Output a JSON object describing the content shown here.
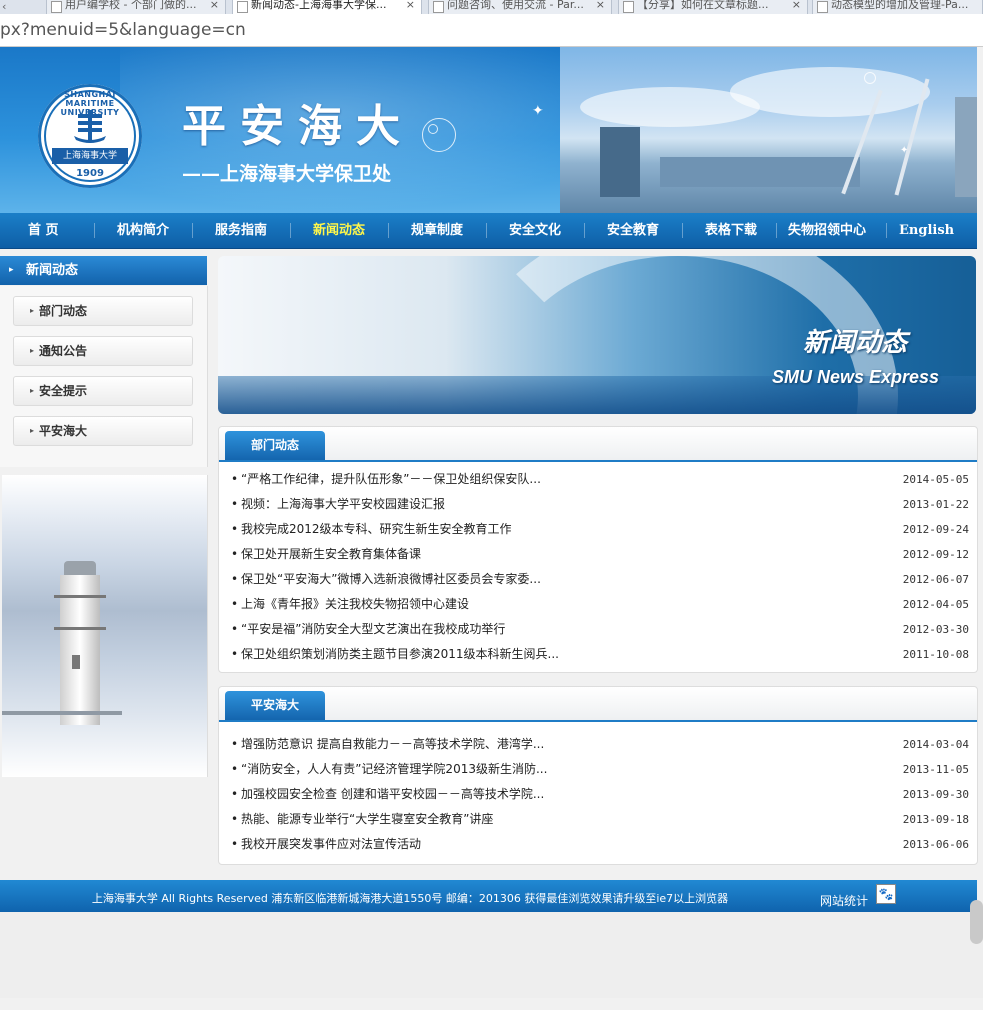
{
  "browser": {
    "tabs": [
      {
        "label": "用户编学校 - 个部门做的..."
      },
      {
        "label": "新闻动态-上海海事大学保..."
      },
      {
        "label": "问题咨询、使用交流 - Par..."
      },
      {
        "label": "【分享】如何在文章标题..."
      },
      {
        "label": "动态模型的增加及管理-Pa..."
      }
    ],
    "url": "px?menuid=5&language=cn"
  },
  "banner": {
    "logo_ring_text": "SHANGHAI MARITIME UNIVERSITY",
    "logo_cn": "上海海事大学",
    "logo_year": "1909",
    "title": "平安海大",
    "subtitle": "——上海海事大学保卫处"
  },
  "nav": {
    "items": [
      {
        "label": "首  页"
      },
      {
        "label": "机构简介"
      },
      {
        "label": "服务指南"
      },
      {
        "label": "新闻动态"
      },
      {
        "label": "规章制度"
      },
      {
        "label": "安全文化"
      },
      {
        "label": "安全教育"
      },
      {
        "label": "表格下载"
      },
      {
        "label": "失物招领中心"
      },
      {
        "label": "English"
      }
    ],
    "active": "新闻动态"
  },
  "sidebar": {
    "header": "新闻动态",
    "items": [
      {
        "label": "部门动态"
      },
      {
        "label": "通知公告"
      },
      {
        "label": "安全提示"
      },
      {
        "label": "平安海大"
      }
    ]
  },
  "hero": {
    "title_cn": "新闻动态",
    "title_en": "SMU News Express"
  },
  "panels": [
    {
      "title": "部门动态",
      "items": [
        {
          "title": "“严格工作纪律，提升队伍形象”－－保卫处组织保安队...",
          "date": "2014-05-05"
        },
        {
          "title": "视频：上海海事大学平安校园建设汇报",
          "date": "2013-01-22"
        },
        {
          "title": "我校完成2012级本专科、研究生新生安全教育工作",
          "date": "2012-09-24"
        },
        {
          "title": "保卫处开展新生安全教育集体备课",
          "date": "2012-09-12"
        },
        {
          "title": "保卫处“平安海大”微博入选新浪微博社区委员会专家委...",
          "date": "2012-06-07"
        },
        {
          "title": "上海《青年报》关注我校失物招领中心建设",
          "date": "2012-04-05"
        },
        {
          "title": "“平安是福”消防安全大型文艺演出在我校成功举行",
          "date": "2012-03-30"
        },
        {
          "title": "保卫处组织策划消防类主题节目参演2011级本科新生阅兵...",
          "date": "2011-10-08"
        }
      ]
    },
    {
      "title": "平安海大",
      "items": [
        {
          "title": "增强防范意识  提高自救能力－－高等技术学院、港湾学...",
          "date": "2014-03-04"
        },
        {
          "title": "“消防安全，人人有责”记经济管理学院2013级新生消防...",
          "date": "2013-11-05"
        },
        {
          "title": "加强校园安全检查  创建和谐平安校园－－高等技术学院...",
          "date": "2013-09-30"
        },
        {
          "title": "热能、能源专业举行“大学生寝室安全教育”讲座",
          "date": "2013-09-18"
        },
        {
          "title": "我校开展突发事件应对法宣传活动",
          "date": "2013-06-06"
        }
      ]
    }
  ],
  "footer": {
    "text": "上海海事大学 All Rights Reserved  浦东新区临港新城海港大道1550号  邮编：201306  获得最佳浏览效果请升级至ie7以上浏览器",
    "stats": "网站统计"
  },
  "icons": {
    "bullet": "•",
    "arrow": "▸",
    "paw": "🐾"
  },
  "colors": {
    "nav_bg": "#0e5ea6",
    "nav_active": "#fff64a",
    "accent": "#1f7cc6"
  }
}
